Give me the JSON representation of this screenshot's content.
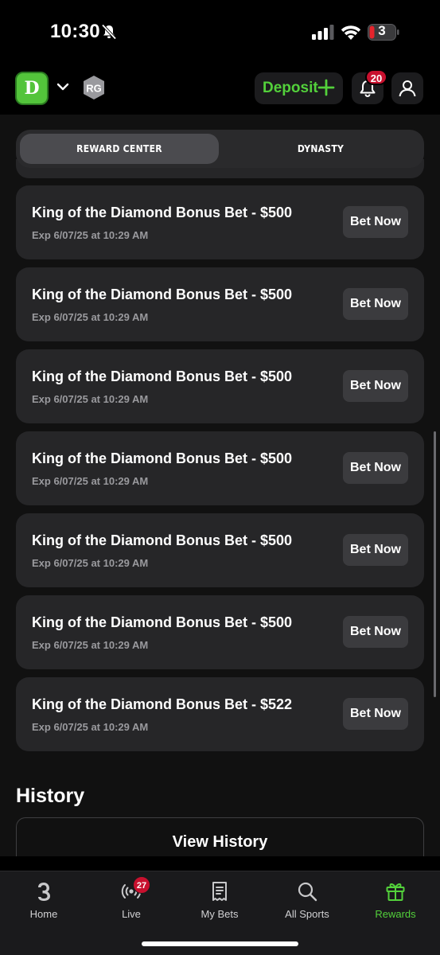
{
  "status_bar": {
    "time": "10:30",
    "battery": "3"
  },
  "header": {
    "logo_text": "D",
    "rg_label": "RG",
    "deposit_label": "Deposit",
    "notification_count": "20"
  },
  "tabs": [
    {
      "label": "REWARD CENTER",
      "active": true
    },
    {
      "label": "DYNASTY",
      "active": false
    }
  ],
  "rewards": [
    {
      "title": "King of the Diamond Bonus Bet - $500",
      "expiry": "Exp 6/07/25 at 10:29 AM",
      "button": "Bet Now"
    },
    {
      "title": "King of the Diamond Bonus Bet - $500",
      "expiry": "Exp 6/07/25 at 10:29 AM",
      "button": "Bet Now"
    },
    {
      "title": "King of the Diamond Bonus Bet - $500",
      "expiry": "Exp 6/07/25 at 10:29 AM",
      "button": "Bet Now"
    },
    {
      "title": "King of the Diamond Bonus Bet - $500",
      "expiry": "Exp 6/07/25 at 10:29 AM",
      "button": "Bet Now"
    },
    {
      "title": "King of the Diamond Bonus Bet - $500",
      "expiry": "Exp 6/07/25 at 10:29 AM",
      "button": "Bet Now"
    },
    {
      "title": "King of the Diamond Bonus Bet - $500",
      "expiry": "Exp 6/07/25 at 10:29 AM",
      "button": "Bet Now"
    },
    {
      "title": "King of the Diamond Bonus Bet - $522",
      "expiry": "Exp 6/07/25 at 10:29 AM",
      "button": "Bet Now"
    }
  ],
  "history": {
    "title": "History",
    "button": "View History"
  },
  "bottom_nav": {
    "items": [
      {
        "label": "Home",
        "icon": "home-logo-icon"
      },
      {
        "label": "Live",
        "icon": "live-broadcast-icon",
        "badge": "27"
      },
      {
        "label": "My Bets",
        "icon": "receipt-icon"
      },
      {
        "label": "All Sports",
        "icon": "search-icon"
      },
      {
        "label": "Rewards",
        "icon": "gift-icon",
        "active": true
      }
    ]
  },
  "colors": {
    "accent_green": "#53d13b",
    "badge_red": "#c8102e",
    "card_bg": "#262628",
    "page_bg": "#111111"
  }
}
